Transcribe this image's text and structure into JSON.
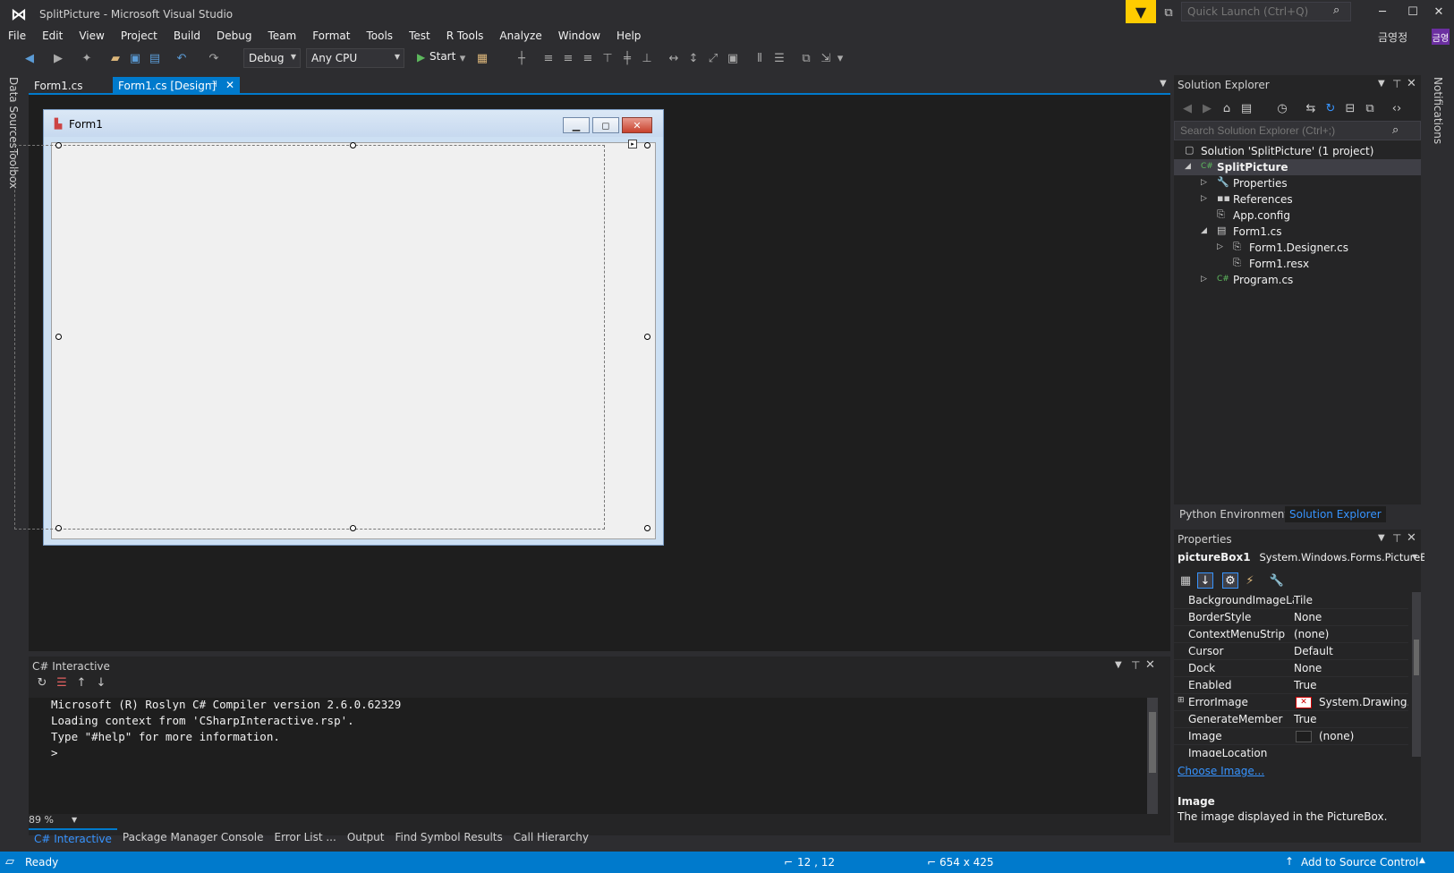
{
  "window": {
    "title": "SplitPicture - Microsoft Visual Studio",
    "quick_launch_placeholder": "Quick Launch (Ctrl+Q)",
    "user_name": "금영정",
    "user_initials": "금영"
  },
  "menu": [
    "File",
    "Edit",
    "View",
    "Project",
    "Build",
    "Debug",
    "Team",
    "Format",
    "Tools",
    "Test",
    "R Tools",
    "Analyze",
    "Window",
    "Help"
  ],
  "toolbar": {
    "config": "Debug",
    "platform": "Any CPU",
    "start_label": "Start"
  },
  "left_tabs": [
    "Data Sources",
    "Toolbox"
  ],
  "right_tabs": [
    "Notifications"
  ],
  "doc_tabs": [
    {
      "label": "Form1.cs",
      "active": false
    },
    {
      "label": "Form1.cs [Design]",
      "active": true
    }
  ],
  "designer": {
    "form_title": "Form1"
  },
  "interactive": {
    "title": "C# Interactive",
    "lines": [
      "Microsoft (R) Roslyn C# Compiler version 2.6.0.62329",
      "Loading context from 'CSharpInteractive.rsp'.",
      "Type \"#help\" for more information.",
      ">"
    ],
    "zoom": "89 %"
  },
  "bottom_tabs": [
    "C# Interactive",
    "Package Manager Console",
    "Error List ...",
    "Output",
    "Find Symbol Results",
    "Call Hierarchy"
  ],
  "solution_explorer": {
    "title": "Solution Explorer",
    "search_placeholder": "Search Solution Explorer (Ctrl+;)",
    "tree": [
      {
        "label": "Solution 'SplitPicture' (1 project)",
        "icon": "solution-icon"
      },
      {
        "label": "SplitPicture",
        "icon": "csharp-project-icon",
        "bold": true
      },
      {
        "label": "Properties",
        "icon": "wrench-icon"
      },
      {
        "label": "References",
        "icon": "references-icon"
      },
      {
        "label": "App.config",
        "icon": "config-file-icon"
      },
      {
        "label": "Form1.cs",
        "icon": "form-icon"
      },
      {
        "label": "Form1.Designer.cs",
        "icon": "cs-file-icon"
      },
      {
        "label": "Form1.resx",
        "icon": "resx-file-icon"
      },
      {
        "label": "Program.cs",
        "icon": "csharp-file-icon"
      }
    ],
    "tabs": [
      "Python Environments",
      "Solution Explorer"
    ]
  },
  "properties": {
    "title": "Properties",
    "object_name": "pictureBox1",
    "object_type": "System.Windows.Forms.PictureBox",
    "rows": [
      {
        "name": "BackgroundImageLay",
        "value": "Tile"
      },
      {
        "name": "BorderStyle",
        "value": "None"
      },
      {
        "name": "ContextMenuStrip",
        "value": "(none)"
      },
      {
        "name": "Cursor",
        "value": "Default"
      },
      {
        "name": "Dock",
        "value": "None"
      },
      {
        "name": "Enabled",
        "value": "True"
      },
      {
        "name": "ErrorImage",
        "value": "System.Drawing.Bi"
      },
      {
        "name": "GenerateMember",
        "value": "True"
      },
      {
        "name": "Image",
        "value": "(none)"
      },
      {
        "name": "ImageLocation",
        "value": ""
      }
    ],
    "choose_image": "Choose Image...",
    "desc_title": "Image",
    "desc_text": "The image displayed in the PictureBox."
  },
  "status": {
    "text": "Ready",
    "position": "12 , 12",
    "size": "654 x 425",
    "source_control": "Add to Source Control"
  }
}
